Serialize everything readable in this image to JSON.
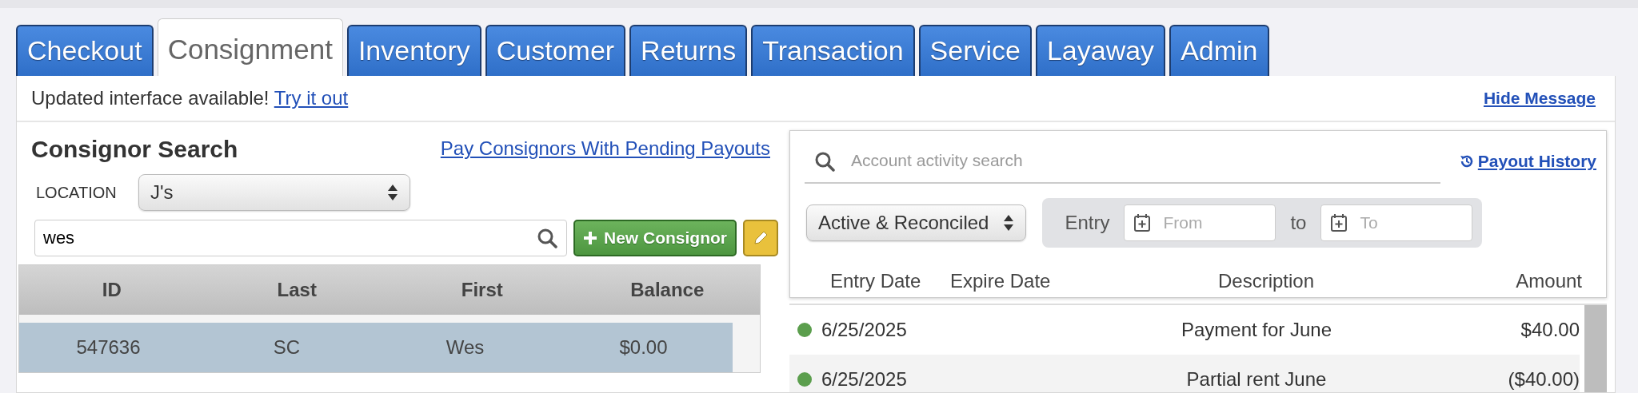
{
  "tabs": [
    {
      "label": "Checkout",
      "selected": false
    },
    {
      "label": "Consignment",
      "selected": true
    },
    {
      "label": "Inventory",
      "selected": false
    },
    {
      "label": "Customer",
      "selected": false
    },
    {
      "label": "Returns",
      "selected": false
    },
    {
      "label": "Transaction",
      "selected": false
    },
    {
      "label": "Service",
      "selected": false
    },
    {
      "label": "Layaway",
      "selected": false
    },
    {
      "label": "Admin",
      "selected": false
    }
  ],
  "message": {
    "text": "Updated interface available!",
    "link": "Try it out",
    "hide": "Hide Message"
  },
  "consignor_search": {
    "title": "Consignor Search",
    "pay_link": "Pay Consignors With Pending Payouts",
    "location_label": "LOCATION",
    "location_value": "J's",
    "search_value": "wes",
    "new_button": "New Consignor",
    "table": {
      "columns": [
        "ID",
        "Last",
        "First",
        "Balance"
      ],
      "rows": [
        {
          "cells": [
            "547636",
            "SC",
            "Wes",
            "$0.00"
          ],
          "selected": true
        }
      ]
    }
  },
  "activity": {
    "search_placeholder": "Account activity search",
    "payout_history": "Payout History",
    "status_filter": "Active & Reconciled",
    "entry_label": "Entry",
    "from_placeholder": "From",
    "to_label": "to",
    "to_placeholder": "To",
    "columns": [
      "Entry Date",
      "Expire Date",
      "Description",
      "Amount"
    ],
    "rows": [
      {
        "color": "#5b9e4d",
        "entry_date": "6/25/2025",
        "description": "Payment for June",
        "amount": "$40.00"
      },
      {
        "color": "#5b9e4d",
        "entry_date": "6/25/2025",
        "description": "Partial rent June",
        "amount": "($40.00)"
      }
    ]
  }
}
